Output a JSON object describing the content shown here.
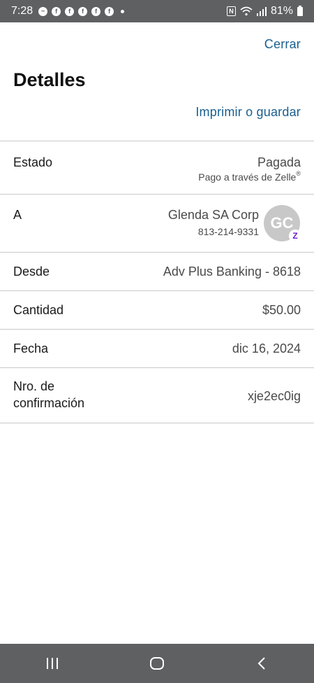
{
  "status_bar": {
    "time": "7:28",
    "notification_icons": [
      "messenger-icon",
      "facebook-icon",
      "facebook-icon",
      "facebook-icon",
      "facebook-icon",
      "facebook-icon"
    ],
    "nfc_label": "N",
    "battery": "81%"
  },
  "header": {
    "close_label": "Cerrar",
    "title": "Detalles",
    "print_label": "Imprimir o guardar"
  },
  "details": {
    "estado": {
      "label": "Estado",
      "value": "Pagada",
      "sub": "Pago a través de Zelle",
      "sub_mark": "®"
    },
    "recipient": {
      "label": "A",
      "name": "Glenda SA Corp",
      "phone": "813-214-9331",
      "initials": "GC",
      "badge": "Z"
    },
    "desde": {
      "label": "Desde",
      "value": "Adv Plus Banking - 8618"
    },
    "cantidad": {
      "label": "Cantidad",
      "value": "$50.00"
    },
    "fecha": {
      "label": "Fecha",
      "value": "dic 16, 2024"
    },
    "confirmacion": {
      "label": "Nro. de confirmación",
      "value": "xje2ec0ig"
    }
  },
  "colors": {
    "link": "#1a5f8f",
    "system_bar": "#5f6062",
    "zelle": "#6d1ed4",
    "avatar_bg": "#c8c8c8"
  }
}
